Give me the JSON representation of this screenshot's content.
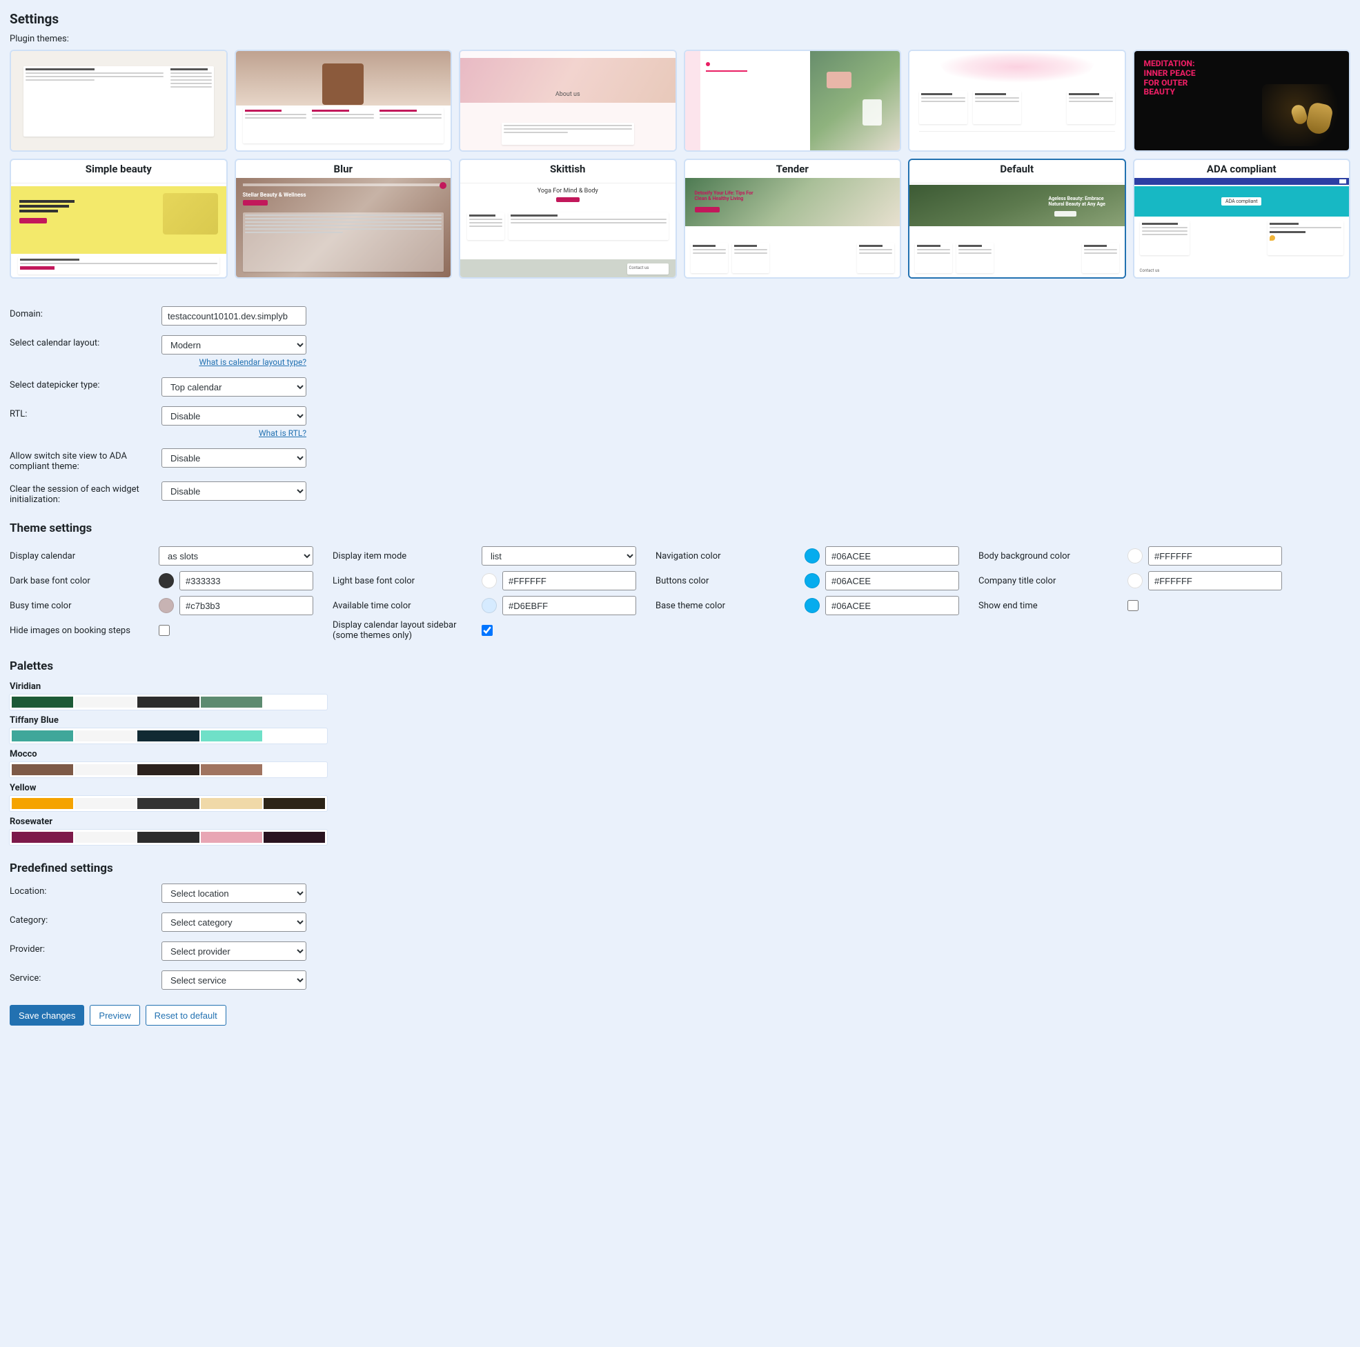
{
  "page_title": "Settings",
  "plugin_themes_label": "Plugin themes:",
  "themes": {
    "row1": [
      {
        "name": "simple-beauty-preview"
      },
      {
        "name": "blur-preview"
      },
      {
        "name": "skittish-preview"
      },
      {
        "name": "tender-preview"
      },
      {
        "name": "default-preview"
      },
      {
        "name": "ada-preview"
      }
    ],
    "row2": [
      {
        "label": "Simple beauty"
      },
      {
        "label": "Blur"
      },
      {
        "label": "Skittish"
      },
      {
        "label": "Tender"
      },
      {
        "label": "Default",
        "selected": true
      },
      {
        "label": "ADA compliant"
      }
    ]
  },
  "form": {
    "domain_label": "Domain:",
    "domain_value": "testaccount10101.dev.simplyb",
    "calendar_layout_label": "Select calendar layout:",
    "calendar_layout_value": "Modern",
    "calendar_layout_help": "What is calendar layout type?",
    "datepicker_label": "Select datepicker type:",
    "datepicker_value": "Top calendar",
    "rtl_label": "RTL:",
    "rtl_value": "Disable",
    "rtl_help": "What is RTL?",
    "ada_switch_label": "Allow switch site view to ADA compliant theme:",
    "ada_switch_value": "Disable",
    "clear_session_label": "Clear the session of each widget initialization:",
    "clear_session_value": "Disable"
  },
  "theme_settings_title": "Theme settings",
  "theme_settings": {
    "display_calendar_label": "Display calendar",
    "display_calendar_value": "as slots",
    "dark_font_label": "Dark base font color",
    "dark_font_swatch": "#333333",
    "dark_font_value": "#333333",
    "busy_label": "Busy time color",
    "busy_swatch": "#c7b3b3",
    "busy_value": "#c7b3b3",
    "hide_images_label": "Hide images on booking steps",
    "hide_images_checked": false,
    "item_mode_label": "Display item mode",
    "item_mode_value": "list",
    "light_font_label": "Light base font color",
    "light_font_swatch": "#ffffff",
    "light_font_value": "#FFFFFF",
    "avail_label": "Available time color",
    "avail_swatch": "#d6ebff",
    "avail_value": "#D6EBFF",
    "sidebar_label": "Display calendar layout sidebar (some themes only)",
    "sidebar_checked": true,
    "nav_label": "Navigation color",
    "nav_swatch": "#06acee",
    "nav_value": "#06ACEE",
    "buttons_label": "Buttons color",
    "buttons_swatch": "#06acee",
    "buttons_value": "#06ACEE",
    "base_theme_label": "Base theme color",
    "base_theme_swatch": "#06acee",
    "base_theme_value": "#06ACEE",
    "body_bg_label": "Body background color",
    "body_bg_swatch": "#ffffff",
    "body_bg_value": "#FFFFFF",
    "company_title_label": "Company title color",
    "company_title_swatch": "#ffffff",
    "company_title_value": "#FFFFFF",
    "show_end_label": "Show end time",
    "show_end_checked": false
  },
  "palettes_title": "Palettes",
  "palettes": [
    {
      "name": "Viridian",
      "colors": [
        "#1d5a36",
        "#f5f5f5",
        "#2c2c2c",
        "#5d8b70",
        "#ffffff"
      ]
    },
    {
      "name": "Tiffany Blue",
      "colors": [
        "#3fa79a",
        "#f5f5f5",
        "#112a33",
        "#6fe0c8",
        "#ffffff"
      ]
    },
    {
      "name": "Mocco",
      "colors": [
        "#7e5a47",
        "#f5f5f5",
        "#2c221d",
        "#a07460",
        "#ffffff"
      ]
    },
    {
      "name": "Yellow",
      "colors": [
        "#f5a300",
        "#f5f5f5",
        "#333333",
        "#f0d9a8",
        "#2c2417"
      ]
    },
    {
      "name": "Rosewater",
      "colors": [
        "#7d1a4a",
        "#f5f5f5",
        "#2c2c2c",
        "#e8a6b4",
        "#2a1420"
      ]
    }
  ],
  "predefined_title": "Predefined settings",
  "predefined": {
    "location_label": "Location:",
    "location_value": "Select location",
    "category_label": "Category:",
    "category_value": "Select category",
    "provider_label": "Provider:",
    "provider_value": "Select provider",
    "service_label": "Service:",
    "service_value": "Select service"
  },
  "buttons": {
    "save": "Save changes",
    "preview": "Preview",
    "reset": "Reset to default"
  }
}
